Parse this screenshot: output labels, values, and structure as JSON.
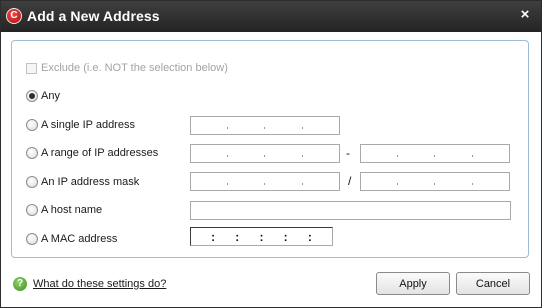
{
  "window": {
    "title": "Add a New Address",
    "logo_letter": "C",
    "close_glyph": "×"
  },
  "exclude": {
    "label": "Exclude (i.e. NOT the selection below)",
    "checked": false,
    "enabled": false
  },
  "options": {
    "any": {
      "label": "Any",
      "selected": true
    },
    "single_ip": {
      "label": "A single IP address",
      "selected": false
    },
    "ip_range": {
      "label": "A range of IP addresses",
      "selected": false,
      "separator": "-"
    },
    "ip_mask": {
      "label": "An IP address mask",
      "selected": false,
      "separator": "/"
    },
    "host_name": {
      "label": "A host name",
      "selected": false,
      "value": ""
    },
    "mac": {
      "label": "A MAC address",
      "selected": false,
      "separators": [
        ":",
        ":",
        ":",
        ":",
        ":"
      ]
    }
  },
  "footer": {
    "help_glyph": "?",
    "help_link": "What do these settings do?",
    "apply_label": "Apply",
    "cancel_label": "Cancel"
  },
  "icons": {
    "logo": "comodo-logo-icon",
    "close": "close-icon",
    "help": "help-icon"
  },
  "colors": {
    "titlebar": "#2f2f2f",
    "panel_border": "#9fbcd2",
    "brand_red": "#c8102e",
    "help_green": "#4fa02a"
  }
}
